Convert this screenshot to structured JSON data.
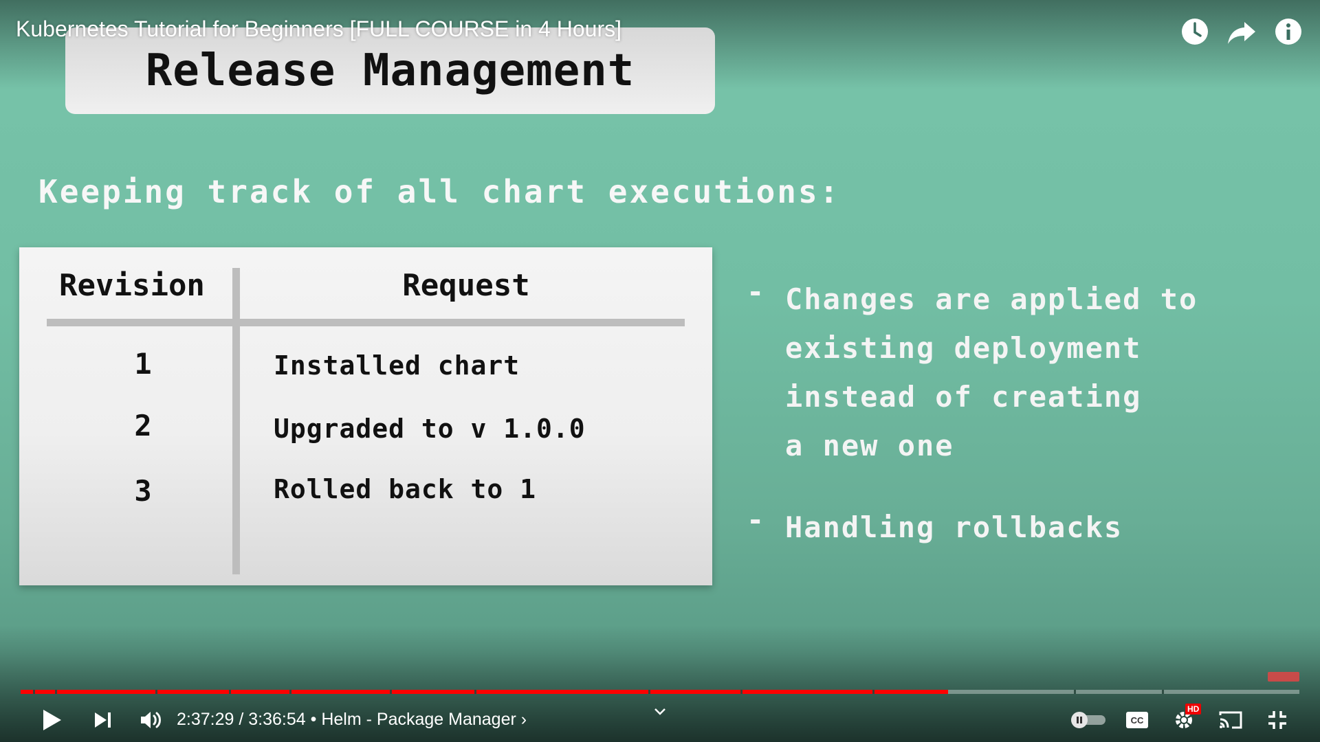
{
  "video": {
    "title": "Kubernetes Tutorial for Beginners [FULL COURSE in 4 Hours]"
  },
  "slide": {
    "title": "Release Management",
    "subtitle": "Keeping track of all chart executions:",
    "table": {
      "headers": [
        "Revision",
        "Request"
      ],
      "rows": [
        {
          "revision": "1",
          "request": "Installed chart"
        },
        {
          "revision": "2",
          "request": "Upgraded to v 1.0.0"
        },
        {
          "revision": "3",
          "request": "Rolled back to 1"
        }
      ]
    },
    "bullets": [
      {
        "dash": "-",
        "lines": [
          "Changes are applied to",
          "existing deployment",
          "instead of creating",
          "a new one"
        ]
      },
      {
        "dash": "-",
        "lines": [
          "Handling rollbacks"
        ]
      }
    ]
  },
  "top_icons": [
    "watch-later-icon",
    "share-icon",
    "info-icon"
  ],
  "player": {
    "current_time": "2:37:29",
    "separator": " / ",
    "duration": "3:36:54",
    "chapter_sep": " • ",
    "chapter": "Helm - Package Manager",
    "chapter_arrow": "›",
    "progress_fraction": 0.7251,
    "hd_label": "HD",
    "accent_color": "#ff0000"
  }
}
